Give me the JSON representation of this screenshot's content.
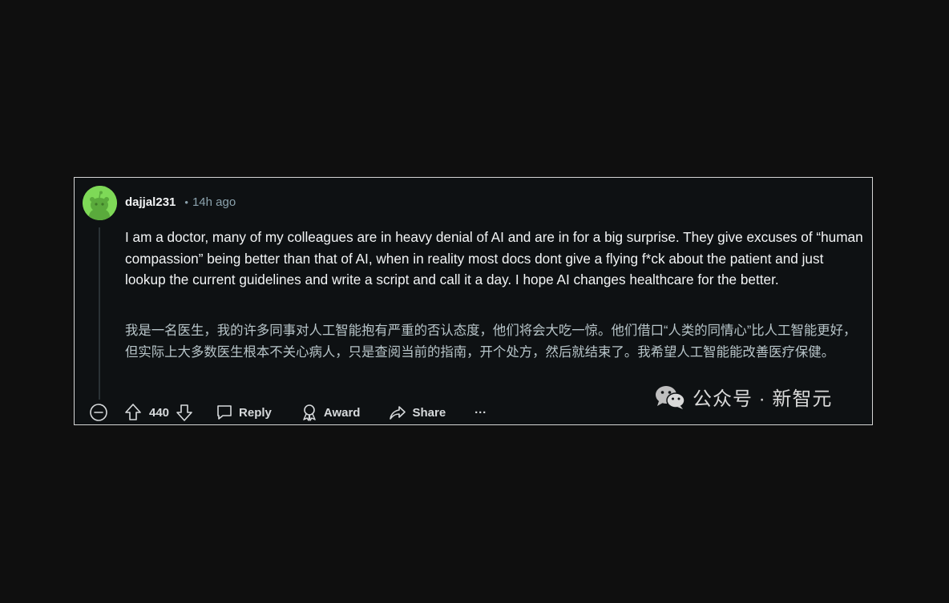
{
  "comment": {
    "username": "dajjal231",
    "separator": "•",
    "time": "14h ago",
    "body_en": "I am a doctor, many of my colleagues are in heavy denial of AI and are in for a big surprise. They give excuses of “human compassion” being better than that of AI, when in reality most docs dont give a flying f*ck about the patient and just lookup the current guidelines and write a script and call it a day. I hope AI changes healthcare for the better.",
    "body_zh": "我是一名医生，我的许多同事对人工智能抱有严重的否认态度，他们将会大吃一惊。他们借口“人类的同情心”比人工智能更好，但实际上大多数医生根本不关心病人，只是查阅当前的指南，开个处方，然后就结束了。我希望人工智能能改善医疗保健。",
    "avatar_color": "#7ed957"
  },
  "actions": {
    "collapse_icon": "minus-circle-icon",
    "upvote_icon": "arrow-up-icon",
    "score": "440",
    "downvote_icon": "arrow-down-icon",
    "reply_label": "Reply",
    "award_label": "Award",
    "share_label": "Share",
    "more_label": "···"
  },
  "watermark": {
    "icon": "wechat-icon",
    "text": "公众号 · 新智元"
  }
}
